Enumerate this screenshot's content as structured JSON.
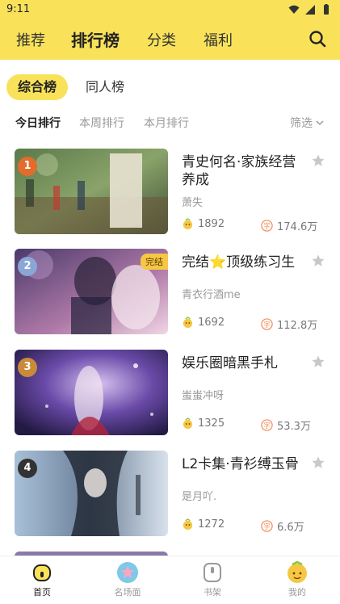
{
  "status": {
    "time": "9:11"
  },
  "topnav": {
    "tabs": [
      {
        "label": "推荐"
      },
      {
        "label": "排行榜"
      },
      {
        "label": "分类"
      },
      {
        "label": "福利"
      }
    ]
  },
  "segments": [
    {
      "label": "综合榜"
    },
    {
      "label": "同人榜"
    }
  ],
  "subtabs": {
    "items": [
      {
        "label": "今日排行"
      },
      {
        "label": "本周排行"
      },
      {
        "label": "本月排行"
      }
    ],
    "filter": "筛选"
  },
  "books": [
    {
      "rank": "1",
      "title": "青史何名·家族经营养成",
      "author": "萧失",
      "likes": "1892",
      "words": "174.6万",
      "badge": ""
    },
    {
      "rank": "2",
      "title": "完结⭐顶级练习生",
      "author": "青衣行酒me",
      "likes": "1692",
      "words": "112.8万",
      "badge": "完结"
    },
    {
      "rank": "3",
      "title": "娱乐圈暗黑手札",
      "author": "蚩蚩冲呀",
      "likes": "1325",
      "words": "53.3万",
      "badge": ""
    },
    {
      "rank": "4",
      "title": "L2卡集·青衫缚玉骨",
      "author": "是月吖.",
      "likes": "1272",
      "words": "6.6万",
      "badge": ""
    }
  ],
  "bottomnav": [
    {
      "label": "首页"
    },
    {
      "label": "名场面"
    },
    {
      "label": "书架"
    },
    {
      "label": "我的"
    }
  ],
  "colors": {
    "accent": "#f9e25a"
  }
}
